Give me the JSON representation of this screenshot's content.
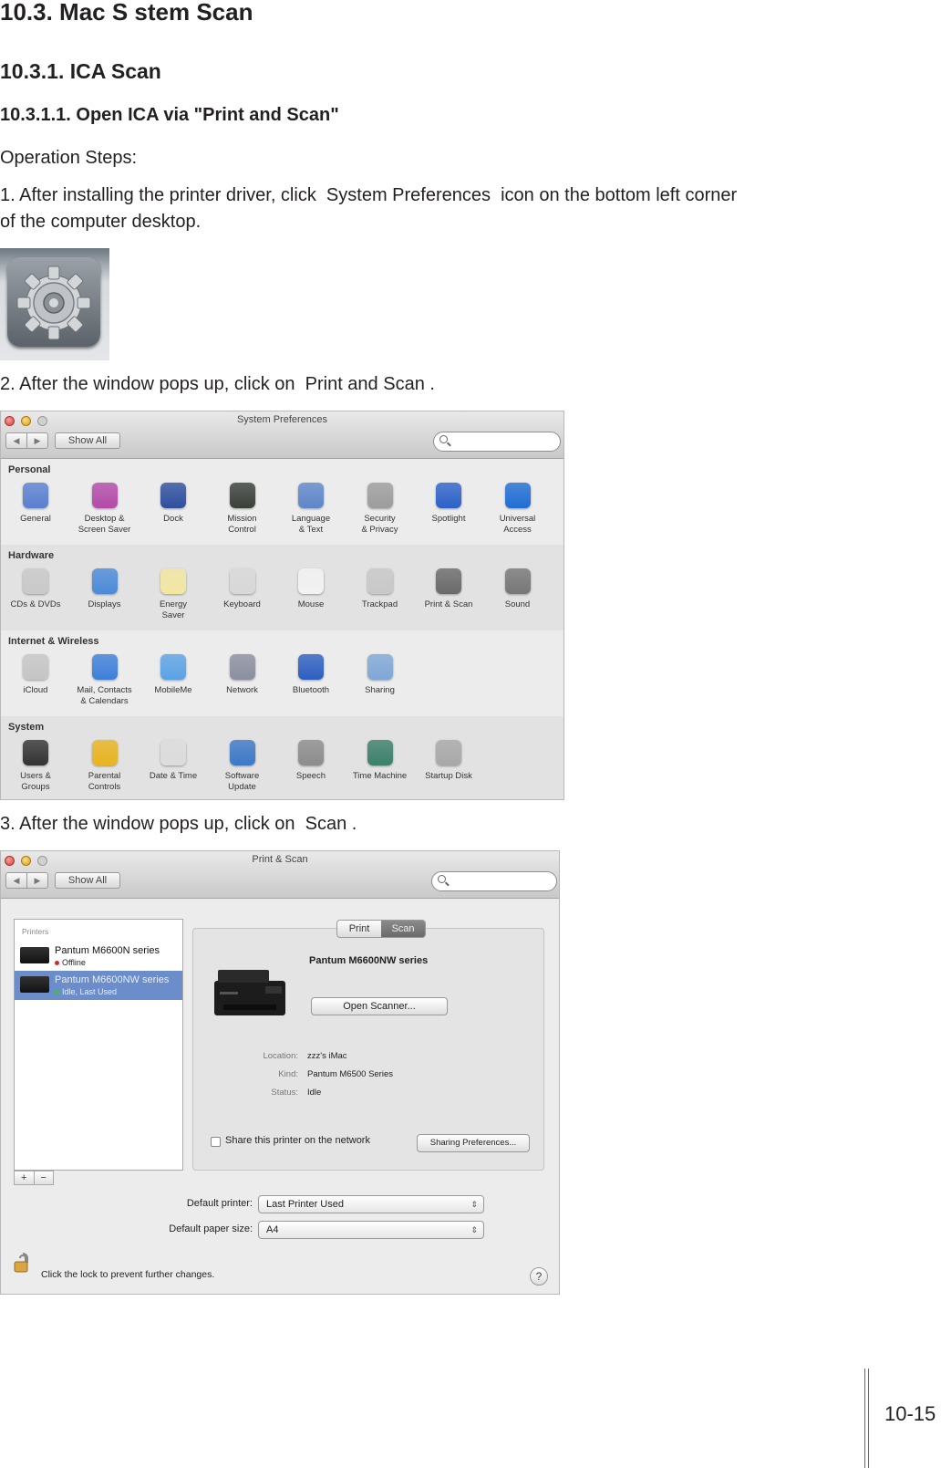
{
  "headings": {
    "h1": "10.3. Mac S  stem Scan",
    "h2": "10.3.1. ICA Scan",
    "h3": "10.3.1.1. Open ICA via \"Print and Scan\""
  },
  "steps": {
    "intro": "Operation Steps:",
    "step1_line1": "1. After installing the printer driver, click  System Preferences  icon on the bottom left corner",
    "step1_line2": "of the computer desktop.",
    "step2": "2. After the window pops up, click on  Print and Scan .",
    "step3": "3. After the window pops up, click on  Scan ."
  },
  "sysprefs": {
    "title": "System Preferences",
    "show_all": "Show All",
    "nav_back": "◀",
    "nav_fwd": "▶",
    "sections": [
      {
        "title": "Personal",
        "items": [
          {
            "label": "General",
            "color": "#5a7fd0",
            "icon": "general-icon"
          },
          {
            "label": "Desktop &\nScreen Saver",
            "color": "#b34aa8",
            "icon": "desktop-icon"
          },
          {
            "label": "Dock",
            "color": "#2f4f9e",
            "icon": "dock-icon"
          },
          {
            "label": "Mission\nControl",
            "color": "#3a3f3a",
            "icon": "mission-control-icon"
          },
          {
            "label": "Language\n& Text",
            "color": "#5f86c8",
            "icon": "language-icon"
          },
          {
            "label": "Security\n& Privacy",
            "color": "#9c9c9c",
            "icon": "security-icon"
          },
          {
            "label": "Spotlight",
            "color": "#2d62c8",
            "icon": "spotlight-icon"
          },
          {
            "label": "Universal\nAccess",
            "color": "#1f6ed4",
            "icon": "universal-access-icon"
          }
        ]
      },
      {
        "title": "Hardware",
        "items": [
          {
            "label": "CDs & DVDs",
            "color": "#c9c9c9",
            "icon": "cd-icon"
          },
          {
            "label": "Displays",
            "color": "#4b8ad8",
            "icon": "displays-icon"
          },
          {
            "label": "Energy\nSaver",
            "color": "#f2e6a0",
            "icon": "energy-icon"
          },
          {
            "label": "Keyboard",
            "color": "#d8d8d8",
            "icon": "keyboard-icon"
          },
          {
            "label": "Mouse",
            "color": "#f2f2f2",
            "icon": "mouse-icon"
          },
          {
            "label": "Trackpad",
            "color": "#c8c8c8",
            "icon": "trackpad-icon"
          },
          {
            "label": "Print & Scan",
            "color": "#6a6a6a",
            "icon": "printer-icon"
          },
          {
            "label": "Sound",
            "color": "#777777",
            "icon": "sound-icon"
          }
        ]
      },
      {
        "title": "Internet & Wireless",
        "items": [
          {
            "label": "iCloud",
            "color": "#c5c5c5",
            "icon": "icloud-icon"
          },
          {
            "label": "Mail, Contacts\n& Calendars",
            "color": "#3d7fd8",
            "icon": "mail-icon"
          },
          {
            "label": "MobileMe",
            "color": "#5aa2e6",
            "icon": "mobileme-icon"
          },
          {
            "label": "Network",
            "color": "#8a8fa0",
            "icon": "network-icon"
          },
          {
            "label": "Bluetooth",
            "color": "#2d5fc0",
            "icon": "bluetooth-icon"
          },
          {
            "label": "Sharing",
            "color": "#7fa7d6",
            "icon": "sharing-icon"
          }
        ]
      },
      {
        "title": "System",
        "items": [
          {
            "label": "Users &\nGroups",
            "color": "#333333",
            "icon": "users-icon"
          },
          {
            "label": "Parental\nControls",
            "color": "#e8b420",
            "icon": "parental-icon"
          },
          {
            "label": "Date & Time",
            "color": "#dcdcdc",
            "icon": "clock-icon"
          },
          {
            "label": "Software\nUpdate",
            "color": "#3d78c8",
            "icon": "update-icon"
          },
          {
            "label": "Speech",
            "color": "#8c8c8c",
            "icon": "microphone-icon"
          },
          {
            "label": "Time Machine",
            "color": "#3b7f6a",
            "icon": "time-machine-icon"
          },
          {
            "label": "Startup Disk",
            "color": "#a8a8a8",
            "icon": "disk-icon"
          }
        ]
      }
    ]
  },
  "printscan": {
    "title": "Print & Scan",
    "show_all": "Show All",
    "list_header": "Printers",
    "printers": [
      {
        "name": "Pantum M6600N series",
        "status": "Offline",
        "dot": "#d22b2b"
      },
      {
        "name": "Pantum M6600NW series",
        "status": "Idle, Last Used",
        "dot": "#3fbf3f"
      }
    ],
    "tab_print": "Print",
    "tab_scan": "Scan",
    "selected_name": "Pantum M6600NW series",
    "open_scanner": "Open Scanner...",
    "location_k": "Location:",
    "location_v": "zzz's iMac",
    "kind_k": "Kind:",
    "kind_v": "Pantum M6500 Series",
    "status_k": "Status:",
    "status_v": "Idle",
    "share_label": "Share this printer on the network",
    "sharing_prefs": "Sharing Preferences...",
    "default_printer_k": "Default printer:",
    "default_printer_v": "Last Printer Used",
    "default_paper_k": "Default paper size:",
    "default_paper_v": "A4",
    "lock_text": "Click the lock to prevent further changes.",
    "help": "?",
    "plus": "+",
    "minus": "−"
  },
  "page_number": "10-15"
}
